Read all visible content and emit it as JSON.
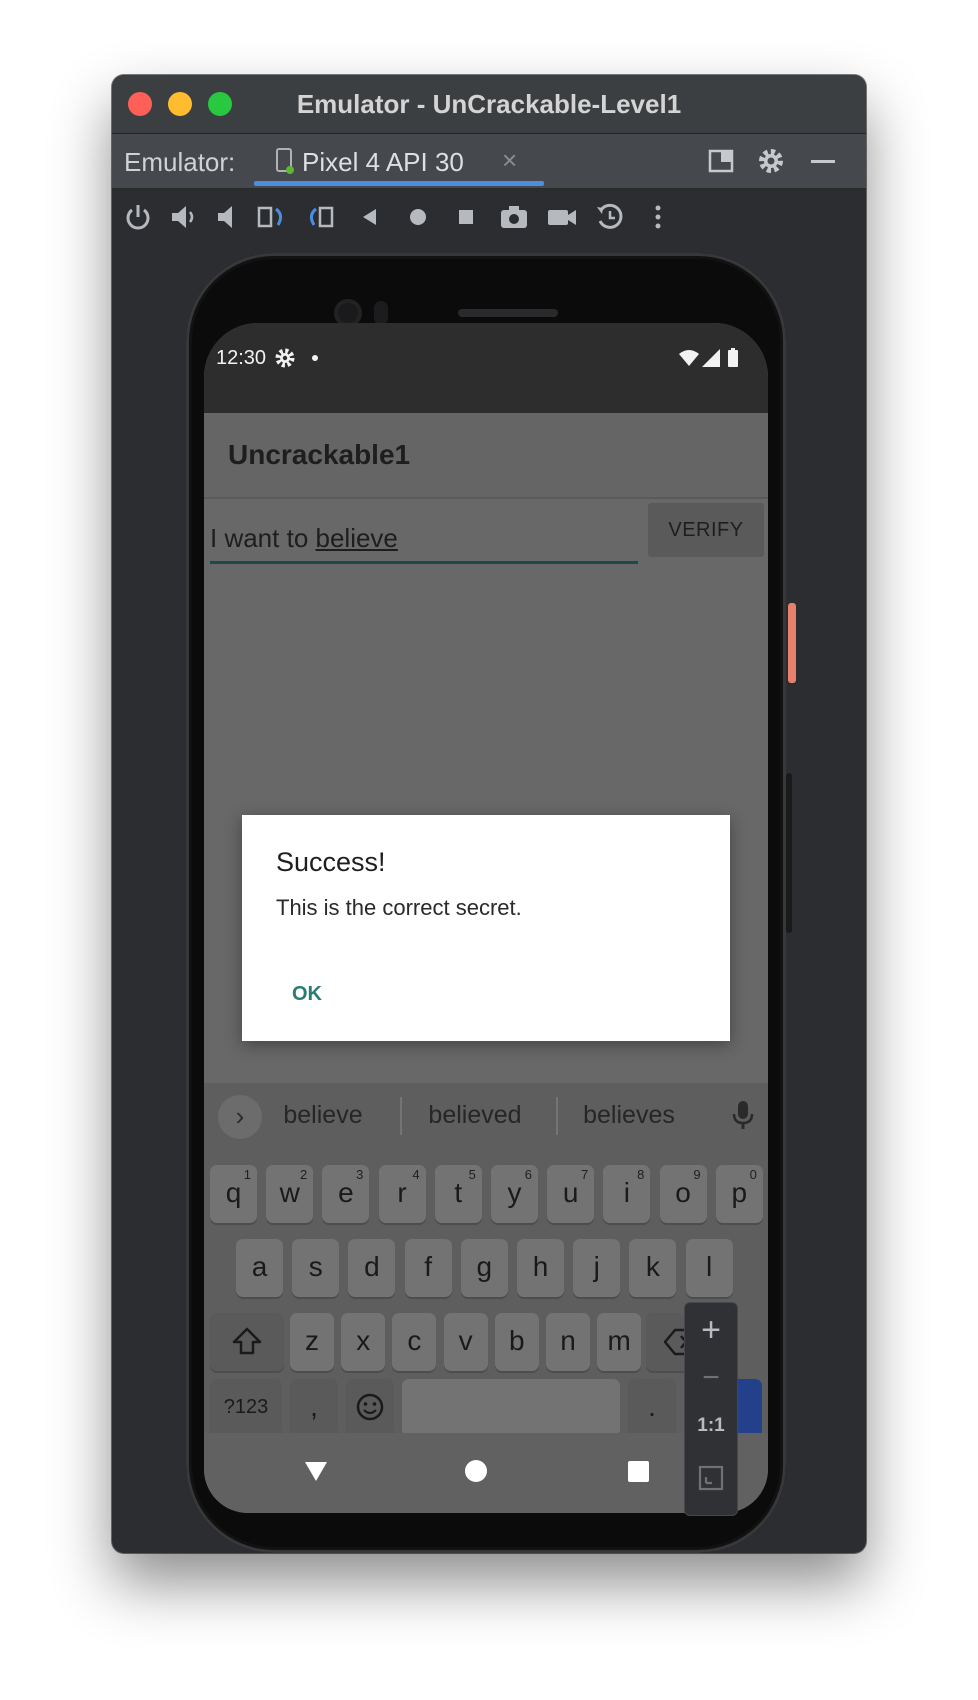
{
  "window": {
    "title": "Emulator - UnCrackable-Level1"
  },
  "tabbar": {
    "prefix": "Emulator:",
    "device_tab": "Pixel 4 API 30",
    "close_glyph": "×"
  },
  "toolbar": {
    "icons": [
      "power-icon",
      "volume-up-icon",
      "volume-down-icon",
      "rotate-left-icon",
      "rotate-right-icon",
      "back-icon",
      "home-icon",
      "overview-icon",
      "screenshot-icon",
      "screen-record-icon",
      "snapshot-icon",
      "more-icon"
    ]
  },
  "statusbar": {
    "time": "12:30"
  },
  "app": {
    "title": "Uncrackable1",
    "input_prefix": "I want to ",
    "input_underlined": "believe",
    "verify_label": "VERIFY"
  },
  "dialog": {
    "title": "Success!",
    "message": "This is the correct secret.",
    "ok_label": "OK"
  },
  "keyboard": {
    "suggestions": [
      "believe",
      "believed",
      "believes"
    ],
    "row1": [
      {
        "k": "q",
        "n": "1"
      },
      {
        "k": "w",
        "n": "2"
      },
      {
        "k": "e",
        "n": "3"
      },
      {
        "k": "r",
        "n": "4"
      },
      {
        "k": "t",
        "n": "5"
      },
      {
        "k": "y",
        "n": "6"
      },
      {
        "k": "u",
        "n": "7"
      },
      {
        "k": "i",
        "n": "8"
      },
      {
        "k": "o",
        "n": "9"
      },
      {
        "k": "p",
        "n": "0"
      }
    ],
    "row2": [
      "a",
      "s",
      "d",
      "f",
      "g",
      "h",
      "j",
      "k",
      "l"
    ],
    "row3": [
      "z",
      "x",
      "c",
      "v",
      "b",
      "n",
      "m"
    ],
    "symbols_label": "?123",
    "comma_label": ",",
    "period_label": "."
  },
  "zoom": {
    "plus": "+",
    "minus": "−",
    "one_to_one": "1:1"
  },
  "colors": {
    "accent_blue": "#4a8ee3",
    "dialog_ok": "#2a7b71",
    "enter_key": "#23418a"
  }
}
